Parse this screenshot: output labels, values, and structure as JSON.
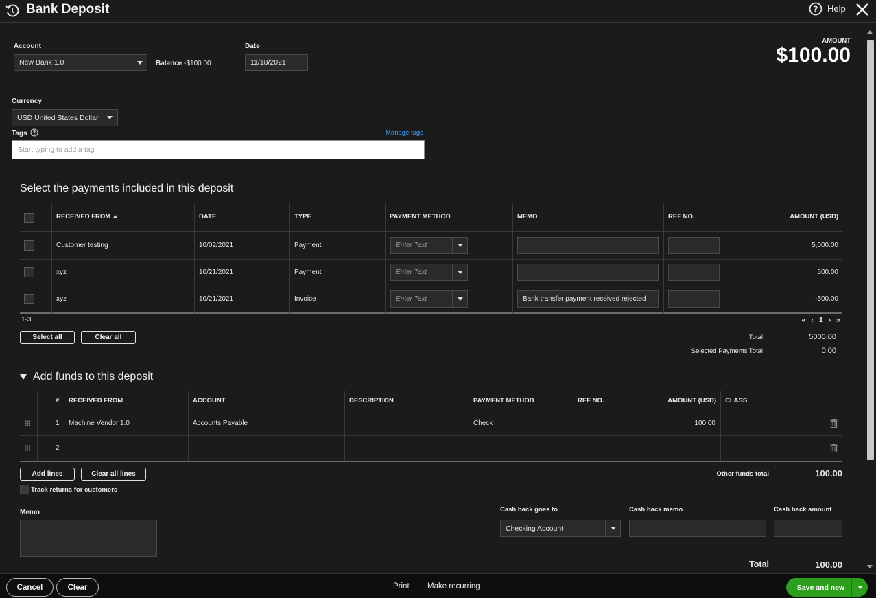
{
  "header": {
    "title": "Bank Deposit",
    "help_label": "Help"
  },
  "account": {
    "label": "Account",
    "value": "New Bank 1.0",
    "balance_label": "Balance",
    "balance_value": "-$100.00"
  },
  "date": {
    "label": "Date",
    "value": "11/18/2021"
  },
  "amount": {
    "label": "AMOUNT",
    "value": "$100.00"
  },
  "currency": {
    "label": "Currency",
    "value": "USD United States Dollar"
  },
  "tags": {
    "label": "Tags",
    "manage_label": "Manage tags",
    "placeholder": "Start typing to add a tag"
  },
  "payments": {
    "title": "Select the payments included in this deposit",
    "columns": [
      "RECEIVED FROM",
      "DATE",
      "TYPE",
      "PAYMENT METHOD",
      "MEMO",
      "REF NO.",
      "AMOUNT (USD)"
    ],
    "method_placeholder": "Enter Text",
    "rows": [
      {
        "received_from": "Customer testing",
        "date": "10/02/2021",
        "type": "Payment",
        "memo": "",
        "amount": "5,000.00"
      },
      {
        "received_from": "xyz",
        "date": "10/21/2021",
        "type": "Payment",
        "memo": "",
        "amount": "500.00"
      },
      {
        "received_from": "xyz",
        "date": "10/21/2021",
        "type": "Invoice",
        "memo": "Bank transfer payment received rejected",
        "amount": "-500.00"
      }
    ],
    "range": "1-3",
    "pager": {
      "first": "«",
      "prev": "‹",
      "page": "1",
      "next": "›",
      "last": "»"
    },
    "select_all": "Select all",
    "clear_all": "Clear all",
    "total_label": "Total",
    "total_value": "5000.00",
    "selected_label": "Selected Payments Total",
    "selected_value": "0.00"
  },
  "funds": {
    "title": "Add funds to this deposit",
    "columns": [
      "#",
      "RECEIVED FROM",
      "ACCOUNT",
      "DESCRIPTION",
      "PAYMENT METHOD",
      "REF NO.",
      "AMOUNT (USD)",
      "CLASS"
    ],
    "rows": [
      {
        "num": "1",
        "received_from": "Machine Vendor 1.0",
        "account": "Accounts Payable",
        "description": "",
        "method": "Check",
        "ref": "",
        "amount": "100.00",
        "class": ""
      },
      {
        "num": "2",
        "received_from": "",
        "account": "",
        "description": "",
        "method": "",
        "ref": "",
        "amount": "",
        "class": ""
      }
    ],
    "add_lines": "Add lines",
    "clear_all_lines": "Clear all lines",
    "other_total_label": "Other funds total",
    "other_total_value": "100.00",
    "track_returns": "Track returns for customers"
  },
  "memo": {
    "label": "Memo"
  },
  "cashback": {
    "goes_to_label": "Cash back goes to",
    "goes_to_value": "Checking Account",
    "memo_label": "Cash back memo",
    "amount_label": "Cash back amount"
  },
  "grand_total": {
    "label": "Total",
    "value": "100.00"
  },
  "footer": {
    "cancel": "Cancel",
    "clear": "Clear",
    "print": "Print",
    "make_recurring": "Make recurring",
    "save_new": "Save and new"
  },
  "colors": {
    "accent_green": "#2ca01c",
    "link_blue": "#3aa0ff",
    "background": "#1b1b1d"
  }
}
